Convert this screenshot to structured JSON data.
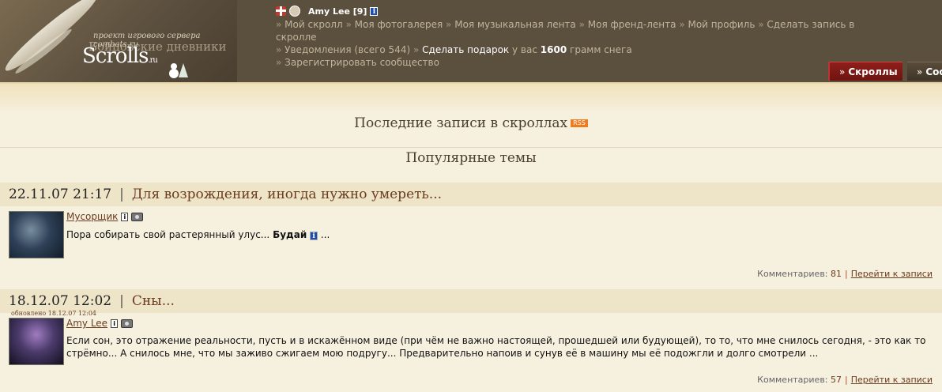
{
  "header": {
    "logo_tagline": "проект игрового сервера combats.ru",
    "logo_title": "Scrolls",
    "logo_subtitle": "Бойцовские дневники",
    "logo_suffix": ".ru",
    "user": {
      "name": "Amy Lee [9]"
    },
    "nav": {
      "items": [
        "Мой скролл",
        "Моя фотогалерея",
        "Моя музыкальная лента",
        "Моя френд-лента",
        "Мой профиль",
        "Сделать запись в скролле"
      ],
      "notifications": "Уведомления (всего 544)",
      "gift_link": "Сделать подарок",
      "snow_prefix": "у вас",
      "snow_amount": "1600",
      "snow_suffix": "грамм снега",
      "register": "Зарегистрировать сообщество",
      "bullet": "»"
    },
    "tabs": {
      "scrolls": "Скроллы",
      "communities": "Соо"
    }
  },
  "latest_heading": "Последние записи в скроллах",
  "rss_label": "RSS",
  "popular_heading": "Популярные темы",
  "posts": [
    {
      "date": "22.11.07 21:17",
      "title": "Для возрождения, иногда нужно умереть...",
      "author": "Мусорщик",
      "text_before": "Пора собирать свой растерянный улус...",
      "text_bold": "Будай",
      "text_after": "...",
      "comments_label": "Комментариев:",
      "comments_count": "81",
      "goto": "Перейти к записи"
    },
    {
      "date": "18.12.07 12:02",
      "title": "Сны...",
      "updated": "обновлено 18.12.07 12:04",
      "author": "Amy Lee",
      "text": "Если сон, это отражение реальности, пусть и в искажённом виде (при чём не важно настоящей, прошедшей или будующей), то то, что мне снилось сегодня, - это как то стрёмно... А снилось мне, что мы заживо сжигаем мою подругу... Предварительно напоив и сунув её в машину мы её подожгли и долго смотрели ...",
      "comments_label": "Комментариев:",
      "comments_count": "57",
      "goto": "Перейти к записи"
    }
  ],
  "colors": {
    "header_bg": "#5b4f3e",
    "accent_red": "#8e1f1a",
    "link_brown": "#6a3b1f",
    "page_bg": "#f6f0df"
  }
}
